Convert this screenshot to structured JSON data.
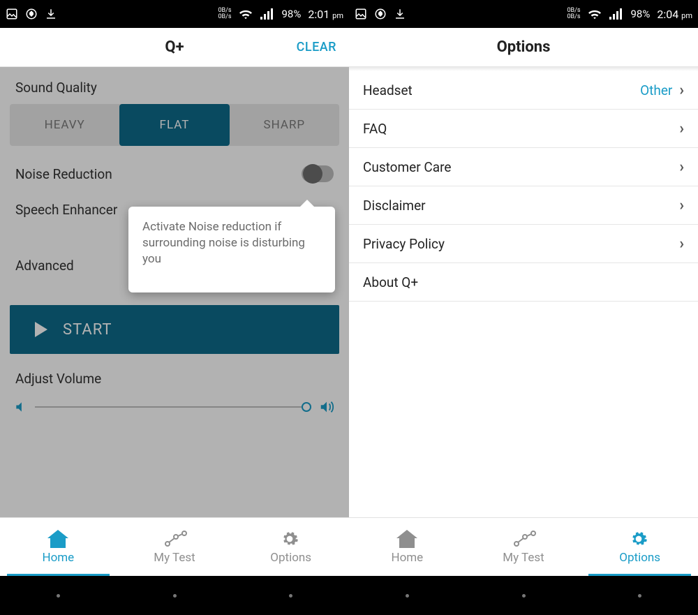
{
  "status": {
    "rate": "0B/s",
    "battery": "98%",
    "time_left": "2:01",
    "time_right": "2:04",
    "ampm": "pm"
  },
  "left": {
    "appbar": {
      "title": "Q+",
      "action": "CLEAR"
    },
    "sound_quality": {
      "label": "Sound Quality",
      "options": [
        "HEAVY",
        "FLAT",
        "SHARP"
      ],
      "selected": "FLAT"
    },
    "noise_reduction": {
      "label": "Noise Reduction",
      "on": false
    },
    "speech_enhancer": {
      "label": "Speech Enhancer"
    },
    "advanced": {
      "label": "Advanced"
    },
    "start": "START",
    "adjust_volume": {
      "label": "Adjust Volume"
    },
    "tooltip": "Activate Noise reduction if surrounding noise is disturbing you",
    "tabs": {
      "home": "Home",
      "mytest": "My Test",
      "options": "Options",
      "active": "home"
    }
  },
  "right": {
    "appbar": {
      "title": "Options"
    },
    "rows": [
      {
        "label": "Headset",
        "value": "Other",
        "arrow": true
      },
      {
        "label": "FAQ",
        "arrow": true
      },
      {
        "label": "Customer Care",
        "arrow": true
      },
      {
        "label": "Disclaimer",
        "arrow": true
      },
      {
        "label": "Privacy Policy",
        "arrow": true
      },
      {
        "label": "About Q+",
        "arrow": false
      }
    ],
    "tabs": {
      "home": "Home",
      "mytest": "My Test",
      "options": "Options",
      "active": "options"
    }
  }
}
